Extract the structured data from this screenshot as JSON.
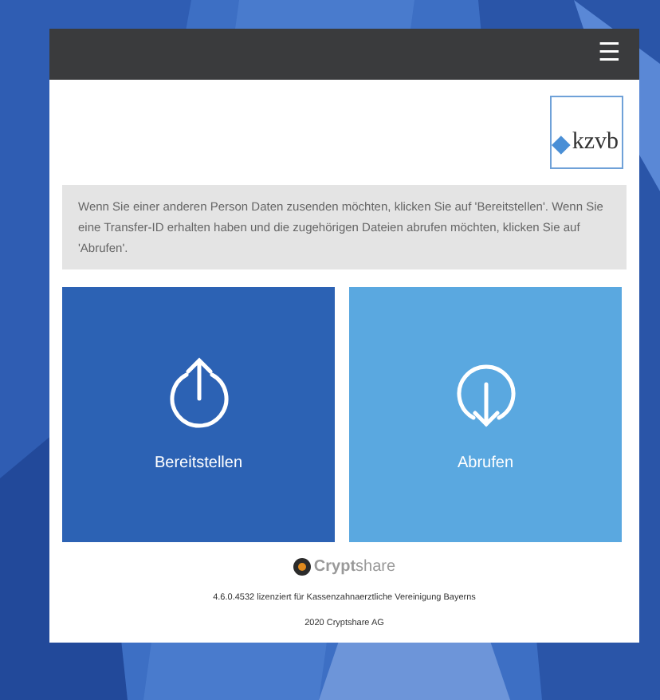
{
  "header": {
    "menu": "☰"
  },
  "logo": {
    "text": "kzvb"
  },
  "info": "Wenn Sie einer anderen Person Daten zusenden möchten, klicken Sie auf 'Bereitstellen'. Wenn Sie eine Transfer-ID erhalten haben und die zugehörigen Dateien abrufen möchten, klicken Sie auf 'Abrufen'.",
  "tiles": [
    {
      "kind": "upload",
      "label": "Bereitstellen"
    },
    {
      "kind": "download",
      "label": "Abrufen"
    }
  ],
  "footer": {
    "brand": "**Crypt**share",
    "license": "4.6.0.4532 lizenziert für Kassenzahnaerztliche Vereinigung Bayerns",
    "copyright": "2020 Cryptshare AG"
  }
}
